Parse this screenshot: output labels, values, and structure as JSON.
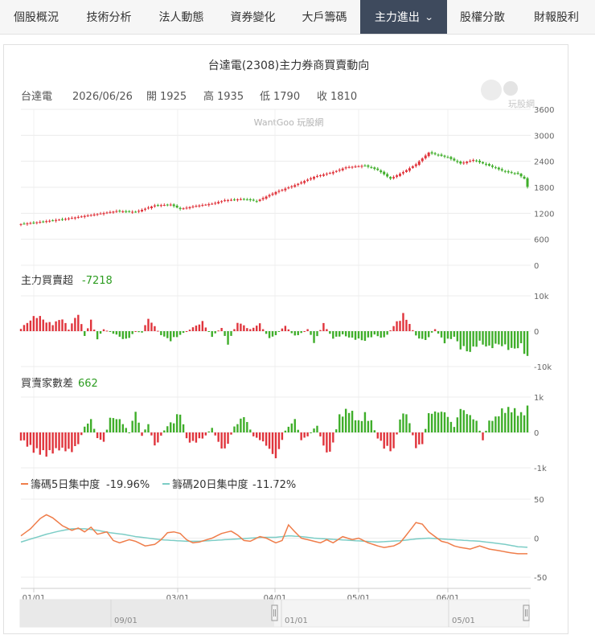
{
  "tabs": [
    {
      "label": "個股概況",
      "active": false
    },
    {
      "label": "技術分析",
      "active": false
    },
    {
      "label": "法人動態",
      "active": false
    },
    {
      "label": "資券變化",
      "active": false
    },
    {
      "label": "大戶籌碼",
      "active": false
    },
    {
      "label": "主力進出",
      "active": true,
      "has_dropdown": true
    },
    {
      "label": "股權分散",
      "active": false
    },
    {
      "label": "財報股利",
      "active": false
    }
  ],
  "colors": {
    "up": "#e0343c",
    "down": "#3fae2a",
    "line5": "#ef7d4a",
    "line20": "#7ccdc6",
    "active_tab": "#3e4a5d",
    "green_text": "#2e9d22"
  },
  "chart": {
    "title": "台達電(2308)主力券商買賣動向",
    "watermark": "WantGoo 玩股網",
    "logo_text": "玩股網",
    "ohlc": {
      "name": "台達電",
      "date": "2026/06/26",
      "open_label": "開",
      "open": "1925",
      "high_label": "高",
      "high": "1935",
      "low_label": "低",
      "low": "1790",
      "close_label": "收",
      "close": "1810"
    },
    "net_label": "主力買賣超",
    "net_value": "-7218",
    "dealers_label": "買賣家數差",
    "dealers_value": "662",
    "legend5_label": "籌碼5日集中度",
    "legend5_value": "-19.96%",
    "legend20_label": "籌碼20日集中度",
    "legend20_value": "-11.72%",
    "price_ticks": [
      "3600",
      "3000",
      "2400",
      "1800",
      "1200",
      "600",
      "0"
    ],
    "net_ticks": [
      "10k",
      "0",
      "-10k"
    ],
    "dealer_ticks": [
      "1k",
      "0",
      "-1k"
    ],
    "conc_ticks": [
      "50",
      "0",
      "-50"
    ],
    "x_ticks": [
      "01/01",
      "03/01",
      "04/01",
      "05/01",
      "06/01"
    ],
    "navigator_ticks": [
      "09/01",
      "01/01",
      "05/01"
    ]
  },
  "chart_data": {
    "type": "line",
    "title": "台達電(2308)主力券商買賣動向",
    "price_axis": {
      "min": 0,
      "max": 3600
    },
    "net_axis": {
      "min": -10000,
      "max": 10000
    },
    "dealer_axis": {
      "min": -1000,
      "max": 1000
    },
    "concentration_axis": {
      "min": -50,
      "max": 50
    },
    "price_anchors": [
      [
        0,
        950
      ],
      [
        6,
        1000
      ],
      [
        14,
        1070
      ],
      [
        22,
        1160
      ],
      [
        30,
        1250
      ],
      [
        36,
        1230
      ],
      [
        42,
        1380
      ],
      [
        47,
        1400
      ],
      [
        50,
        1300
      ],
      [
        55,
        1370
      ],
      [
        60,
        1420
      ],
      [
        64,
        1500
      ],
      [
        70,
        1530
      ],
      [
        74,
        1480
      ],
      [
        80,
        1690
      ],
      [
        86,
        1850
      ],
      [
        92,
        2040
      ],
      [
        98,
        2150
      ],
      [
        102,
        2260
      ],
      [
        108,
        2300
      ],
      [
        112,
        2200
      ],
      [
        116,
        2000
      ],
      [
        120,
        2150
      ],
      [
        124,
        2330
      ],
      [
        128,
        2600
      ],
      [
        134,
        2490
      ],
      [
        138,
        2350
      ],
      [
        142,
        2430
      ],
      [
        147,
        2300
      ],
      [
        152,
        2160
      ],
      [
        156,
        2110
      ],
      [
        158,
        2000
      ],
      [
        159,
        1810
      ]
    ],
    "net_anchors": [
      [
        0,
        800
      ],
      [
        5,
        4500
      ],
      [
        8,
        2500
      ],
      [
        10,
        2000
      ],
      [
        13,
        3500
      ],
      [
        15,
        500
      ],
      [
        18,
        5000
      ],
      [
        20,
        -1500
      ],
      [
        22,
        3000
      ],
      [
        24,
        -2000
      ],
      [
        26,
        500
      ],
      [
        30,
        -1000
      ],
      [
        33,
        -2500
      ],
      [
        36,
        0
      ],
      [
        38,
        -500
      ],
      [
        40,
        3500
      ],
      [
        44,
        -1000
      ],
      [
        47,
        -2500
      ],
      [
        50,
        -1000
      ],
      [
        54,
        1000
      ],
      [
        57,
        2500
      ],
      [
        60,
        -1500
      ],
      [
        63,
        1000
      ],
      [
        65,
        -3500
      ],
      [
        68,
        2500
      ],
      [
        72,
        500
      ],
      [
        75,
        2000
      ],
      [
        78,
        -2000
      ],
      [
        80,
        -1000
      ],
      [
        83,
        1500
      ],
      [
        86,
        -1500
      ],
      [
        90,
        500
      ],
      [
        92,
        -3000
      ],
      [
        95,
        2000
      ],
      [
        98,
        -2000
      ],
      [
        101,
        -1000
      ],
      [
        104,
        -2000
      ],
      [
        108,
        -2500
      ],
      [
        111,
        -1000
      ],
      [
        114,
        -2000
      ],
      [
        118,
        2500
      ],
      [
        120,
        4500
      ],
      [
        122,
        2000
      ],
      [
        124,
        -1500
      ],
      [
        127,
        -2500
      ],
      [
        130,
        500
      ],
      [
        133,
        -3000
      ],
      [
        136,
        -1500
      ],
      [
        138,
        -4500
      ],
      [
        141,
        -5500
      ],
      [
        144,
        -3000
      ],
      [
        147,
        -4500
      ],
      [
        150,
        -3500
      ],
      [
        154,
        -5000
      ],
      [
        157,
        -4000
      ],
      [
        159,
        -7218
      ]
    ],
    "dealer_anchors": [
      [
        0,
        -200
      ],
      [
        4,
        -500
      ],
      [
        8,
        -600
      ],
      [
        12,
        -450
      ],
      [
        16,
        -500
      ],
      [
        18,
        -300
      ],
      [
        20,
        150
      ],
      [
        22,
        350
      ],
      [
        24,
        -150
      ],
      [
        26,
        -250
      ],
      [
        28,
        400
      ],
      [
        31,
        350
      ],
      [
        34,
        0
      ],
      [
        36,
        600
      ],
      [
        38,
        -100
      ],
      [
        40,
        250
      ],
      [
        42,
        -400
      ],
      [
        46,
        200
      ],
      [
        48,
        300
      ],
      [
        50,
        600
      ],
      [
        52,
        -200
      ],
      [
        54,
        -300
      ],
      [
        58,
        -100
      ],
      [
        60,
        150
      ],
      [
        62,
        -300
      ],
      [
        64,
        -500
      ],
      [
        67,
        150
      ],
      [
        70,
        450
      ],
      [
        73,
        -100
      ],
      [
        76,
        -250
      ],
      [
        78,
        -450
      ],
      [
        80,
        -700
      ],
      [
        83,
        50
      ],
      [
        86,
        350
      ],
      [
        88,
        -200
      ],
      [
        90,
        -100
      ],
      [
        93,
        200
      ],
      [
        95,
        -400
      ],
      [
        97,
        -600
      ],
      [
        100,
        450
      ],
      [
        103,
        650
      ],
      [
        106,
        300
      ],
      [
        108,
        500
      ],
      [
        110,
        300
      ],
      [
        112,
        -150
      ],
      [
        114,
        -400
      ],
      [
        117,
        -500
      ],
      [
        119,
        400
      ],
      [
        121,
        550
      ],
      [
        124,
        -400
      ],
      [
        126,
        -300
      ],
      [
        128,
        500
      ],
      [
        130,
        550
      ],
      [
        133,
        550
      ],
      [
        136,
        150
      ],
      [
        138,
        650
      ],
      [
        141,
        450
      ],
      [
        143,
        300
      ],
      [
        145,
        -200
      ],
      [
        147,
        300
      ],
      [
        149,
        400
      ],
      [
        151,
        600
      ],
      [
        154,
        650
      ],
      [
        157,
        500
      ],
      [
        159,
        662
      ]
    ],
    "conc5_anchors": [
      [
        0,
        3
      ],
      [
        3,
        12
      ],
      [
        6,
        25
      ],
      [
        8,
        30
      ],
      [
        10,
        26
      ],
      [
        13,
        16
      ],
      [
        16,
        10
      ],
      [
        18,
        13
      ],
      [
        20,
        8
      ],
      [
        22,
        14
      ],
      [
        24,
        5
      ],
      [
        27,
        8
      ],
      [
        29,
        -3
      ],
      [
        31,
        -6
      ],
      [
        34,
        -2
      ],
      [
        36,
        -4
      ],
      [
        39,
        -10
      ],
      [
        42,
        -8
      ],
      [
        44,
        -2
      ],
      [
        46,
        7
      ],
      [
        48,
        8
      ],
      [
        50,
        6
      ],
      [
        52,
        -2
      ],
      [
        54,
        -6
      ],
      [
        56,
        -5
      ],
      [
        60,
        0
      ],
      [
        63,
        6
      ],
      [
        66,
        9
      ],
      [
        68,
        4
      ],
      [
        70,
        -3
      ],
      [
        72,
        -4
      ],
      [
        75,
        2
      ],
      [
        77,
        0
      ],
      [
        80,
        -6
      ],
      [
        82,
        -3
      ],
      [
        84,
        17
      ],
      [
        86,
        8
      ],
      [
        88,
        0
      ],
      [
        91,
        -3
      ],
      [
        94,
        -6
      ],
      [
        96,
        -2
      ],
      [
        98,
        -6
      ],
      [
        101,
        2
      ],
      [
        104,
        -2
      ],
      [
        106,
        0
      ],
      [
        109,
        -6
      ],
      [
        112,
        -10
      ],
      [
        114,
        -12
      ],
      [
        117,
        -10
      ],
      [
        119,
        -6
      ],
      [
        121,
        4
      ],
      [
        124,
        20
      ],
      [
        126,
        18
      ],
      [
        128,
        8
      ],
      [
        130,
        2
      ],
      [
        132,
        -4
      ],
      [
        134,
        -6
      ],
      [
        136,
        -10
      ],
      [
        138,
        -12
      ],
      [
        141,
        -14
      ],
      [
        144,
        -10
      ],
      [
        147,
        -14
      ],
      [
        150,
        -16
      ],
      [
        154,
        -19
      ],
      [
        156,
        -20
      ],
      [
        159,
        -19.96
      ]
    ],
    "conc20_anchors": [
      [
        0,
        -5
      ],
      [
        4,
        0
      ],
      [
        8,
        5
      ],
      [
        12,
        9
      ],
      [
        16,
        12
      ],
      [
        20,
        12
      ],
      [
        24,
        10
      ],
      [
        28,
        7
      ],
      [
        32,
        5
      ],
      [
        36,
        2
      ],
      [
        40,
        0
      ],
      [
        44,
        -2
      ],
      [
        48,
        -3
      ],
      [
        52,
        -4
      ],
      [
        56,
        -4
      ],
      [
        60,
        -3
      ],
      [
        64,
        -2
      ],
      [
        68,
        -1
      ],
      [
        72,
        0
      ],
      [
        76,
        1
      ],
      [
        80,
        1
      ],
      [
        84,
        3
      ],
      [
        88,
        2
      ],
      [
        92,
        0
      ],
      [
        96,
        -1
      ],
      [
        100,
        -2
      ],
      [
        104,
        -3
      ],
      [
        108,
        -4
      ],
      [
        112,
        -5
      ],
      [
        116,
        -4
      ],
      [
        120,
        -3
      ],
      [
        124,
        -1
      ],
      [
        128,
        0
      ],
      [
        132,
        -1
      ],
      [
        136,
        -2
      ],
      [
        140,
        -3
      ],
      [
        144,
        -4
      ],
      [
        148,
        -6
      ],
      [
        152,
        -8
      ],
      [
        156,
        -11
      ],
      [
        159,
        -11.72
      ]
    ]
  }
}
